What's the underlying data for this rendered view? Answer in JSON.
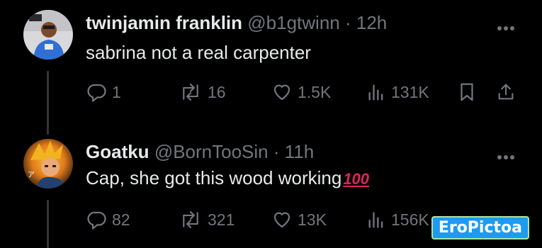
{
  "tweets": [
    {
      "display_name": "twinjamin franklin",
      "handle": "@b1gtwinn",
      "separator": "·",
      "time": "12h",
      "text": "sabrina not a real carpenter",
      "replies": "1",
      "reposts": "16",
      "likes": "1.5K",
      "views": "131K"
    },
    {
      "display_name": "Goatku",
      "handle": "@BornTooSin",
      "separator": "·",
      "time": "11h",
      "text": "Cap, she got this wood working",
      "emoji": "100",
      "replies": "82",
      "reposts": "321",
      "likes": "13K",
      "views": "156K"
    }
  ],
  "watermark": "EroPictoa",
  "colors": {
    "background": "#000000",
    "text": "#e7e9ea",
    "muted": "#71767b",
    "thread_line": "#333639",
    "emoji_red": "#e0245e"
  },
  "icons": [
    "reply-icon",
    "repost-icon",
    "like-icon",
    "views-icon",
    "bookmark-icon",
    "share-icon",
    "more-icon"
  ]
}
